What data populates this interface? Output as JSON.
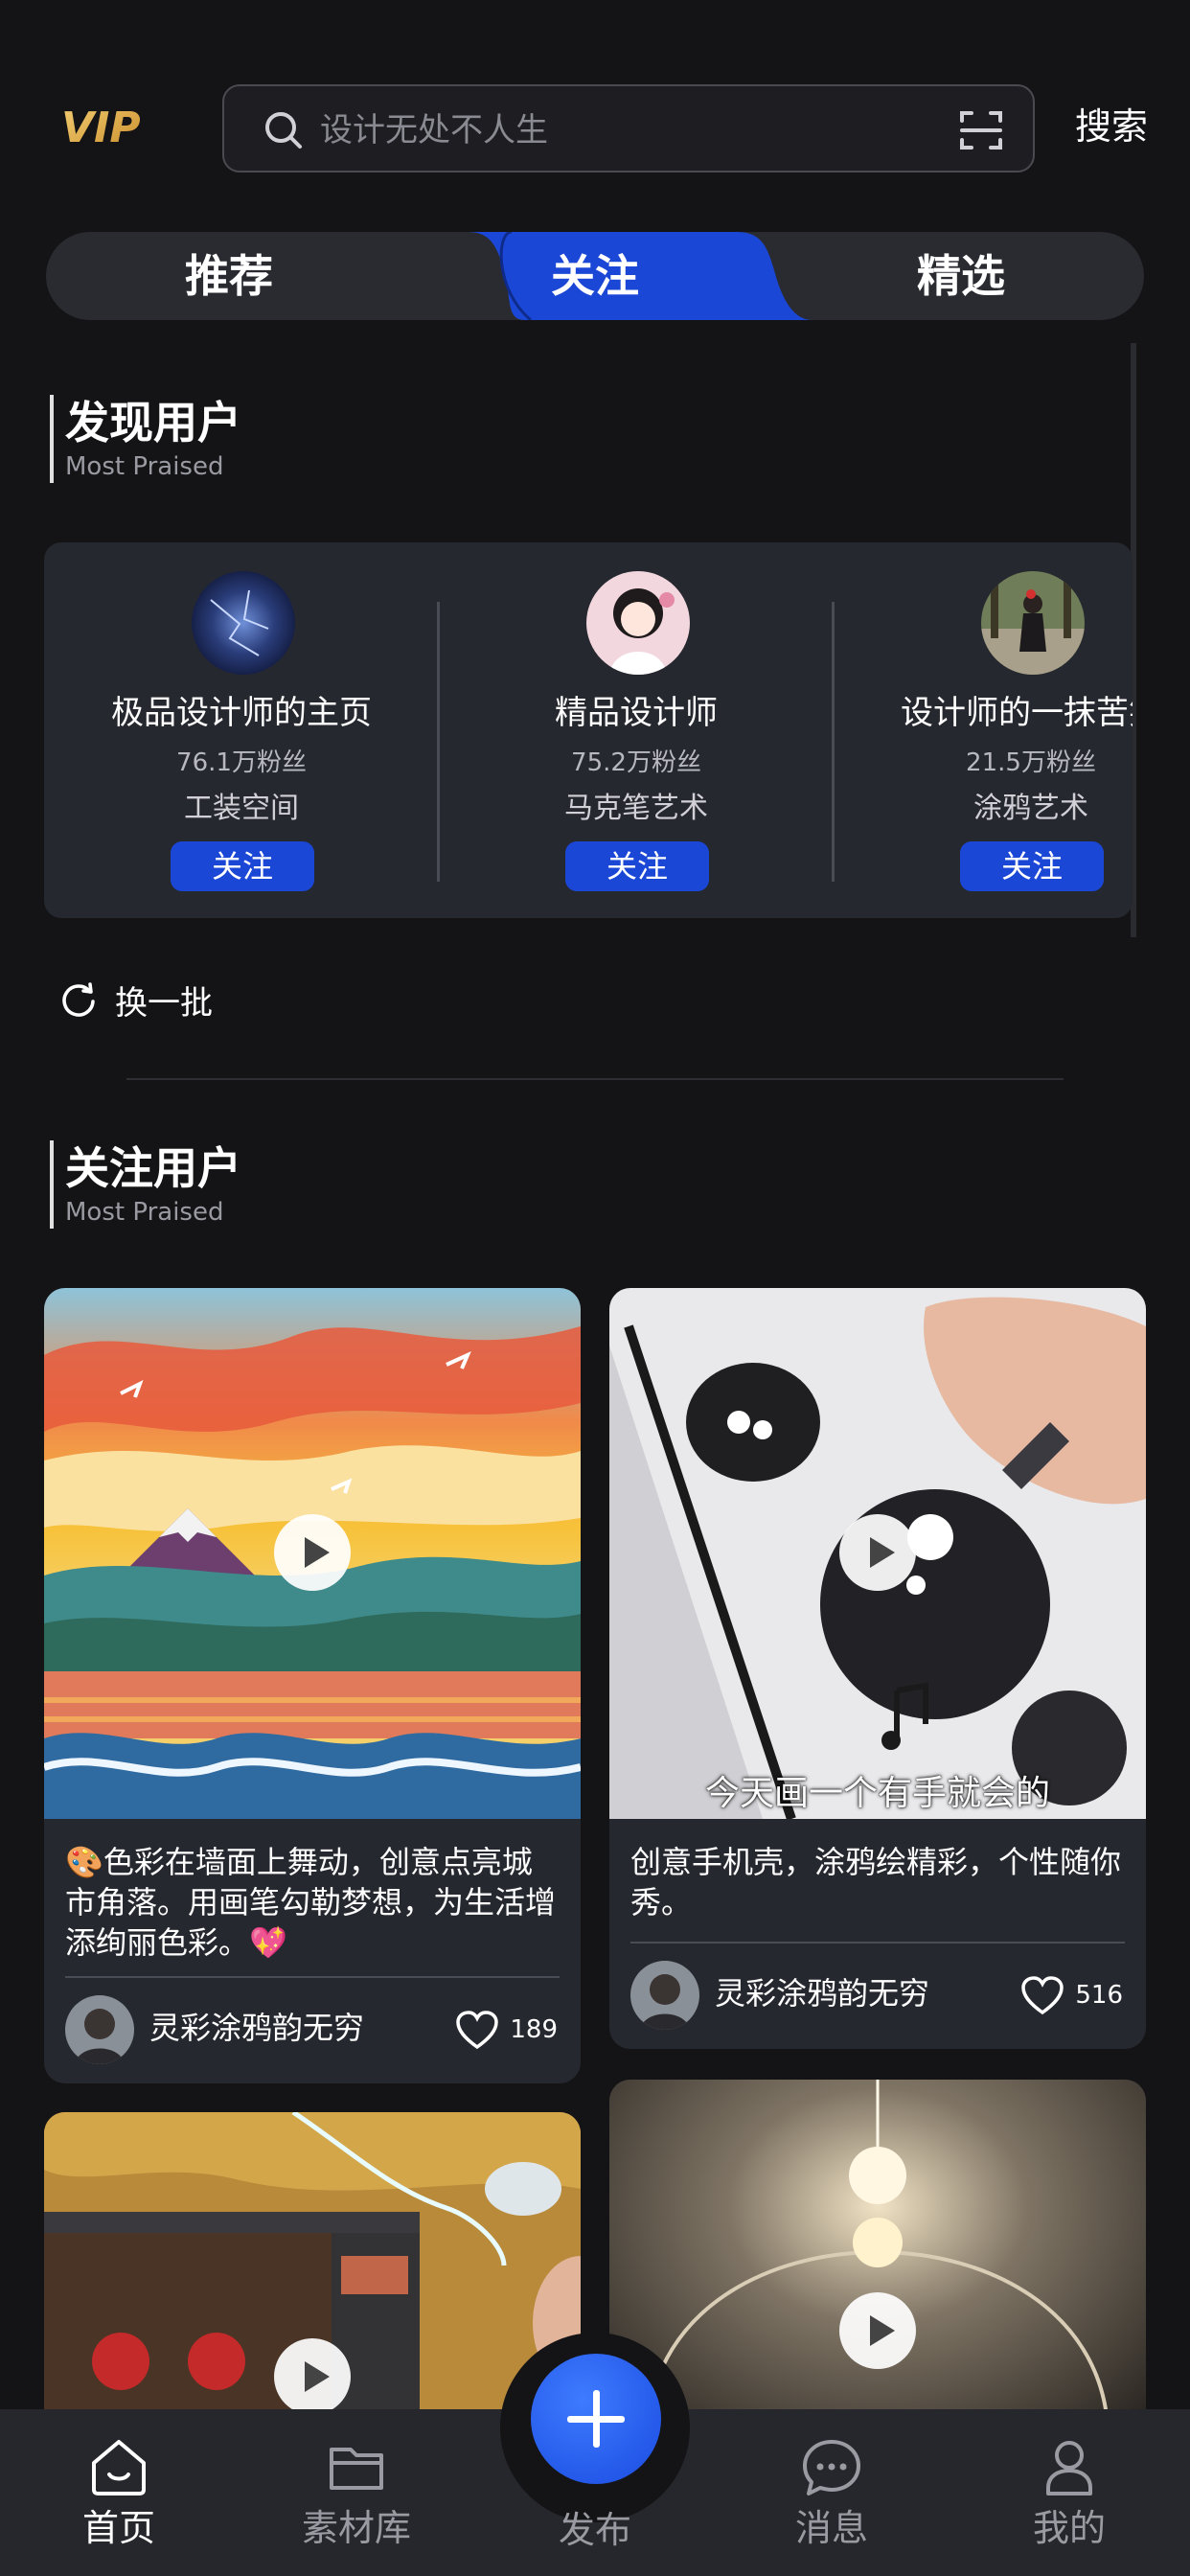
{
  "header": {
    "logo": "VIP",
    "search_placeholder": "设计无处不人生",
    "search_button": "搜索"
  },
  "tabs": [
    {
      "label": "推荐",
      "active": false
    },
    {
      "label": "关注",
      "active": true
    },
    {
      "label": "精选",
      "active": false
    }
  ],
  "discover": {
    "title": "发现用户",
    "subtitle": "Most Praised",
    "users": [
      {
        "name": "极品设计师的主页",
        "fans": "76.1万粉丝",
        "tag": "工装空间",
        "follow": "关注"
      },
      {
        "name": "精品设计师",
        "fans": "75.2万粉丝",
        "tag": "马克笔艺术",
        "follow": "关注"
      },
      {
        "name": "设计师的一抹苦笑",
        "fans": "21.5万粉丝",
        "tag": "涂鸦艺术",
        "follow": "关注"
      }
    ],
    "refresh": "换一批"
  },
  "following": {
    "title": "关注用户",
    "subtitle": "Most Praised",
    "posts": [
      {
        "desc": "🎨色彩在墙面上舞动，创意点亮城市角落。用画笔勾勒梦想，为生活增添绚丽色彩。💖",
        "author": "灵彩涂鸦韵无穷",
        "likes": "189"
      },
      {
        "desc": "创意手机壳，涂鸦绘精彩，个性随你秀。",
        "author": "灵彩涂鸦韵无穷",
        "likes": "516",
        "overlay_text": "今天画一个有手就会的"
      },
      {
        "desc": "",
        "author": "",
        "likes": ""
      },
      {
        "desc": "",
        "author": "",
        "likes": ""
      }
    ]
  },
  "bottom_nav": [
    {
      "label": "首页",
      "icon": "home-icon",
      "active": true
    },
    {
      "label": "素材库",
      "icon": "folder-icon",
      "active": false
    },
    {
      "label": "发布",
      "icon": "plus-icon",
      "active": false
    },
    {
      "label": "消息",
      "icon": "chat-icon",
      "active": false
    },
    {
      "label": "我的",
      "icon": "user-icon",
      "active": false
    }
  ],
  "colors": {
    "background": "#141416",
    "accent_blue": "#1a47d6",
    "card": "#26282f",
    "vip_gold": "#e8b54a"
  }
}
